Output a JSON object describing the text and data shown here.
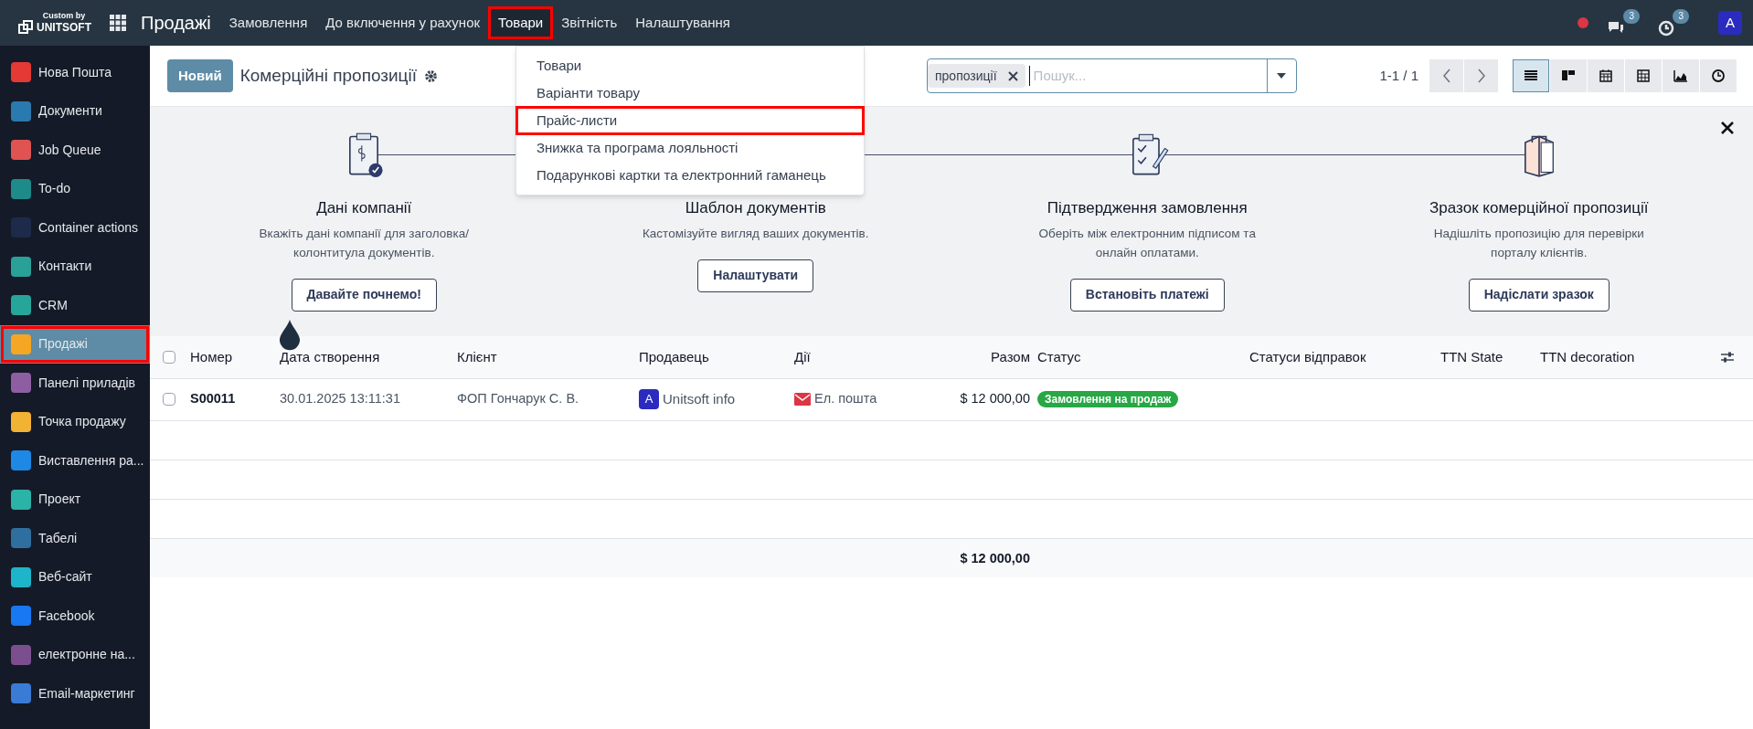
{
  "top_bar": {
    "brand_caption": "Custom by",
    "brand_name": "UNITSOFT",
    "app_title": "Продажі",
    "menu": [
      {
        "label": "Замовлення",
        "selected": false,
        "highlighted": false
      },
      {
        "label": "До включення у рахунок",
        "selected": false,
        "highlighted": false
      },
      {
        "label": "Товари",
        "selected": true,
        "highlighted": true
      },
      {
        "label": "Звітність",
        "selected": false,
        "highlighted": false
      },
      {
        "label": "Налаштування",
        "selected": false,
        "highlighted": false
      }
    ],
    "systray": {
      "chat_count": "3",
      "activity_count": "3",
      "avatar": "A"
    }
  },
  "sidebar": {
    "items": [
      {
        "label": "Нова Пошта",
        "color": "#e53935",
        "selected": false,
        "highlighted": false
      },
      {
        "label": "Документи",
        "color": "#2a7ab0",
        "selected": false,
        "highlighted": false
      },
      {
        "label": "Job Queue",
        "color": "#e05353",
        "selected": false,
        "highlighted": false
      },
      {
        "label": "To-do",
        "color": "#1f8a8a",
        "selected": false,
        "highlighted": false
      },
      {
        "label": "Container actions",
        "color": "#1e2a4a",
        "selected": false,
        "highlighted": false
      },
      {
        "label": "Контакти",
        "color": "#2aa198",
        "selected": false,
        "highlighted": false
      },
      {
        "label": "CRM",
        "color": "#26a69a",
        "selected": false,
        "highlighted": false
      },
      {
        "label": "Продажі",
        "color": "#f5a623",
        "selected": true,
        "highlighted": true
      },
      {
        "label": "Панелі приладів",
        "color": "#8e5ea2",
        "selected": false,
        "highlighted": false
      },
      {
        "label": "Точка продажу",
        "color": "#f2b233",
        "selected": false,
        "highlighted": false
      },
      {
        "label": "Виставлення ра...",
        "color": "#1e88e5",
        "selected": false,
        "highlighted": false
      },
      {
        "label": "Проект",
        "color": "#2ab3a6",
        "selected": false,
        "highlighted": false
      },
      {
        "label": "Табелі",
        "color": "#2f6f9f",
        "selected": false,
        "highlighted": false
      },
      {
        "label": "Веб-сайт",
        "color": "#1cb5c9",
        "selected": false,
        "highlighted": false
      },
      {
        "label": "Facebook",
        "color": "#1877f2",
        "selected": false,
        "highlighted": false
      },
      {
        "label": "електронне на...",
        "color": "#7b4f8e",
        "selected": false,
        "highlighted": false
      },
      {
        "label": "Email-маркетинг",
        "color": "#3a7bd5",
        "selected": false,
        "highlighted": false
      }
    ]
  },
  "control_panel": {
    "new_button": "Новий",
    "title": "Комерційні пропозиції",
    "facet": "пропозиції",
    "search_placeholder": "Пошук...",
    "pager": "1-1 / 1",
    "views": [
      {
        "kind": "list",
        "selected": true
      },
      {
        "kind": "kanban",
        "selected": false
      },
      {
        "kind": "calendar",
        "selected": false
      },
      {
        "kind": "pivot",
        "selected": false
      },
      {
        "kind": "graph",
        "selected": false
      },
      {
        "kind": "activity",
        "selected": false
      }
    ]
  },
  "dropdown_menu": {
    "items": [
      {
        "label": "Товари",
        "highlighted": false
      },
      {
        "label": "Варіанти товару",
        "highlighted": false
      },
      {
        "label": "Прайс-листи",
        "highlighted": true
      },
      {
        "label": "Знижка та програма лояльності",
        "highlighted": false
      },
      {
        "label": "Подарункові картки та електронний гаманець",
        "highlighted": false
      }
    ]
  },
  "onboarding": {
    "steps": [
      {
        "kind": "company",
        "title": "Дані компанії",
        "description": "Вкажіть дані компанії для заголовка/ колонтитула документів.",
        "button": "Давайте почнемо!"
      },
      {
        "kind": "template",
        "title": "Шаблон документів",
        "description": "Кастомізуйте вигляд ваших документів.",
        "button": "Налаштувати"
      },
      {
        "kind": "confirm",
        "title": "Підтвердження замовлення",
        "description": "Оберіть між електронним підписом та онлайн оплатами.",
        "button": "Встановіть платежі"
      },
      {
        "kind": "sample",
        "title": "Зразок комерційної пропозиції",
        "description": "Надішліть пропозицію для перевірки порталу клієнтів.",
        "button": "Надіслати зразок"
      }
    ]
  },
  "table": {
    "columns": [
      "Номер",
      "Дата створення",
      "Клієнт",
      "Продавець",
      "Дії",
      "Разом",
      "Статус",
      "Статуси відправок",
      "TTN State",
      "TTN decoration"
    ],
    "rows": [
      {
        "checked": false,
        "number": "S00011",
        "date": "30.01.2025 13:11:31",
        "customer": "ФОП Гончарук С. В.",
        "salesperson_avatar": "A",
        "salesperson": "Unitsoft info",
        "activity": "Ел. пошта",
        "total": "$ 12 000,00",
        "status": "Замовлення на продаж"
      }
    ],
    "select_all_checked": false,
    "footer_total": "$ 12 000,00"
  }
}
